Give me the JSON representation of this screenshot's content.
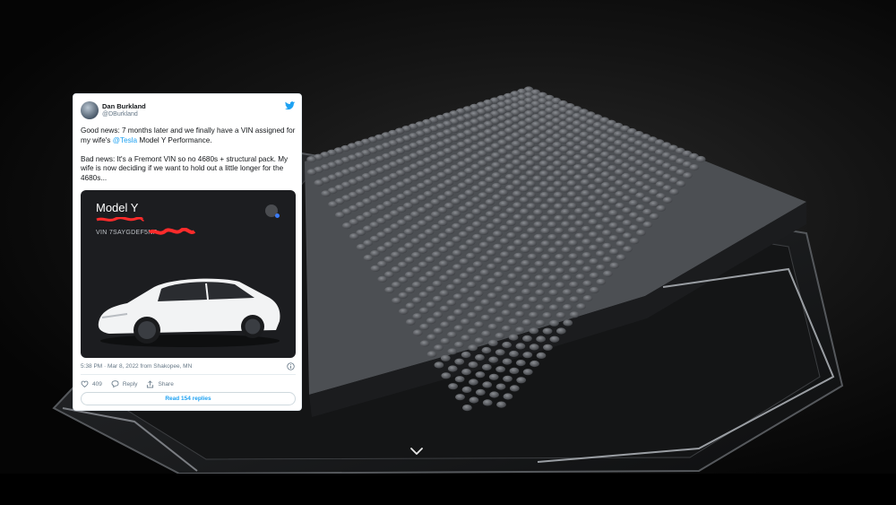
{
  "tweet": {
    "author_name": "Dan Burkland",
    "author_handle": "@DBurkland",
    "text_para1_before": "Good news: 7 months later and we finally have a VIN assigned for my wife's ",
    "mention": "@Tesla",
    "text_para1_after": " Model Y Performance.",
    "text_para2": "Bad news: It's a Fremont VIN so no 4680s + structural pack. My wife is now deciding if we want to hold out a little longer for the 4680s...",
    "timestamp": "5:38 PM · Mar 8, 2022 from Shakopee, MN",
    "likes": "409",
    "reply_label": "Reply",
    "share_label": "Share",
    "read_replies": "Read 154 replies",
    "media": {
      "title": "Model Y",
      "vin_label": "VIN 7SAYGDEF5NF"
    }
  },
  "colors": {
    "twitter_blue": "#1da1f2",
    "redaction_red": "#ff2b2b",
    "car_white": "#f2f3f4"
  }
}
